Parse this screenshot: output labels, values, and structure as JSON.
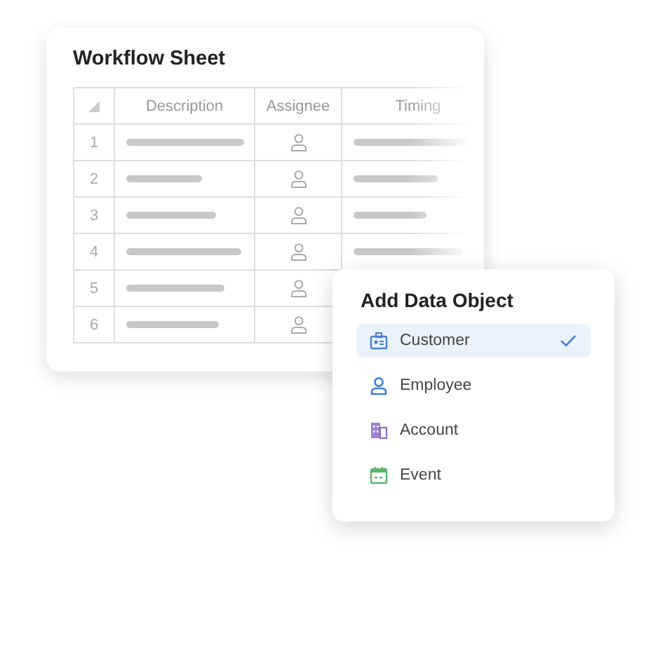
{
  "sheet": {
    "title": "Workflow Sheet",
    "columns": [
      "Description",
      "Assignee",
      "Timing"
    ],
    "rows": [
      {
        "number": "1"
      },
      {
        "number": "2"
      },
      {
        "number": "3"
      },
      {
        "number": "4"
      },
      {
        "number": "5"
      },
      {
        "number": "6"
      }
    ]
  },
  "menu": {
    "title": "Add Data Object",
    "items": [
      {
        "label": "Customer",
        "kind": "badge",
        "color": "#4a7fd6",
        "selected": true
      },
      {
        "label": "Employee",
        "kind": "person",
        "color": "#3f7fd8",
        "selected": false
      },
      {
        "label": "Account",
        "kind": "building",
        "color": "#8e6bc9",
        "selected": false
      },
      {
        "label": "Event",
        "kind": "calendar",
        "color": "#5ab56a",
        "selected": false
      }
    ]
  }
}
